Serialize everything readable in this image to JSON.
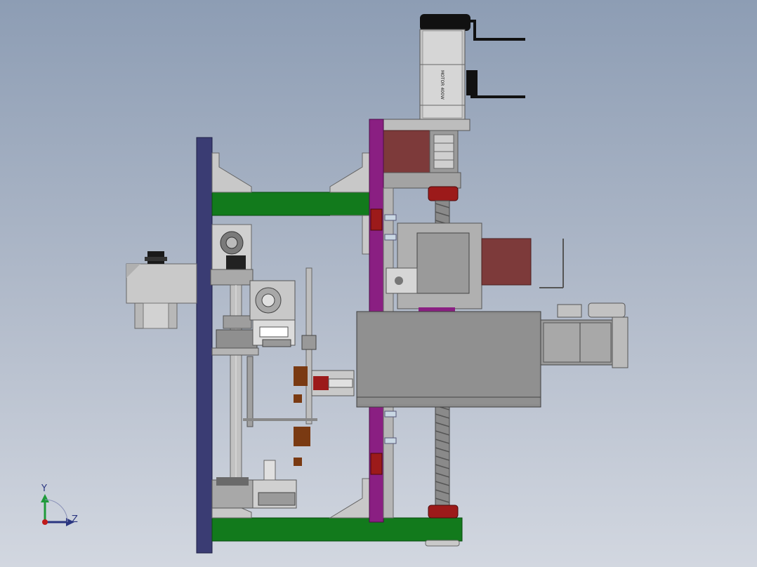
{
  "colors": {
    "background_top": "#8d9db4",
    "background_bottom": "#d2d7e0",
    "base_plate": "#3a3c73",
    "green_beam": "#127a1c",
    "purple_plate": "#8a1f82",
    "steel_gray": "#8c8c8c",
    "light_gray": "#bdbdbd",
    "maroon_block": "#7d3a3a",
    "red_nut": "#9c1a1a",
    "brown_block": "#7a3a12",
    "black": "#111111"
  },
  "triad": {
    "y_label": "Y",
    "z_label": "Z"
  },
  "motor_label": "MOTOR 400W"
}
